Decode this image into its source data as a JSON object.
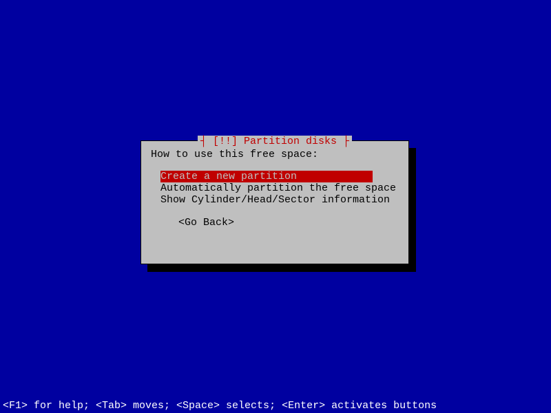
{
  "dialog": {
    "title": "┤ [!!] Partition disks ├",
    "prompt": "How to use this free space:",
    "options": [
      "Create a new partition",
      "Automatically partition the free space",
      "Show Cylinder/Head/Sector information"
    ],
    "selected_index": 0,
    "go_back_label": "<Go Back>"
  },
  "help_bar": "<F1> for help; <Tab> moves; <Space> selects; <Enter> activates buttons"
}
